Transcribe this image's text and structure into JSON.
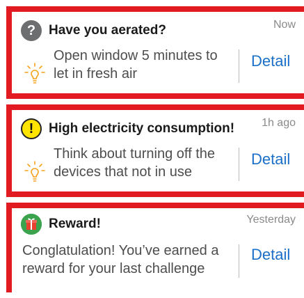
{
  "notifications": [
    {
      "icon": "question-icon",
      "badge_symbol": "?",
      "title": "Have you aerated?",
      "time": "Now",
      "message": "Open window 5 minutes to let in fresh air",
      "detail_label": "Detail"
    },
    {
      "icon": "exclamation-icon",
      "badge_symbol": "!",
      "title": "High electricity consumption!",
      "time": "1h ago",
      "message": "Think about turning off the devices that not in use",
      "detail_label": "Detail"
    },
    {
      "icon": "gift-icon",
      "title": "Reward!",
      "time": "Yesterday",
      "message": "Conglatulation! You’ve earned a reward for your last challenge",
      "detail_label": "Detail"
    }
  ],
  "colors": {
    "accent_border": "#e21b23",
    "detail_link": "#1b6fc8",
    "bulb": "#f5a21b"
  }
}
